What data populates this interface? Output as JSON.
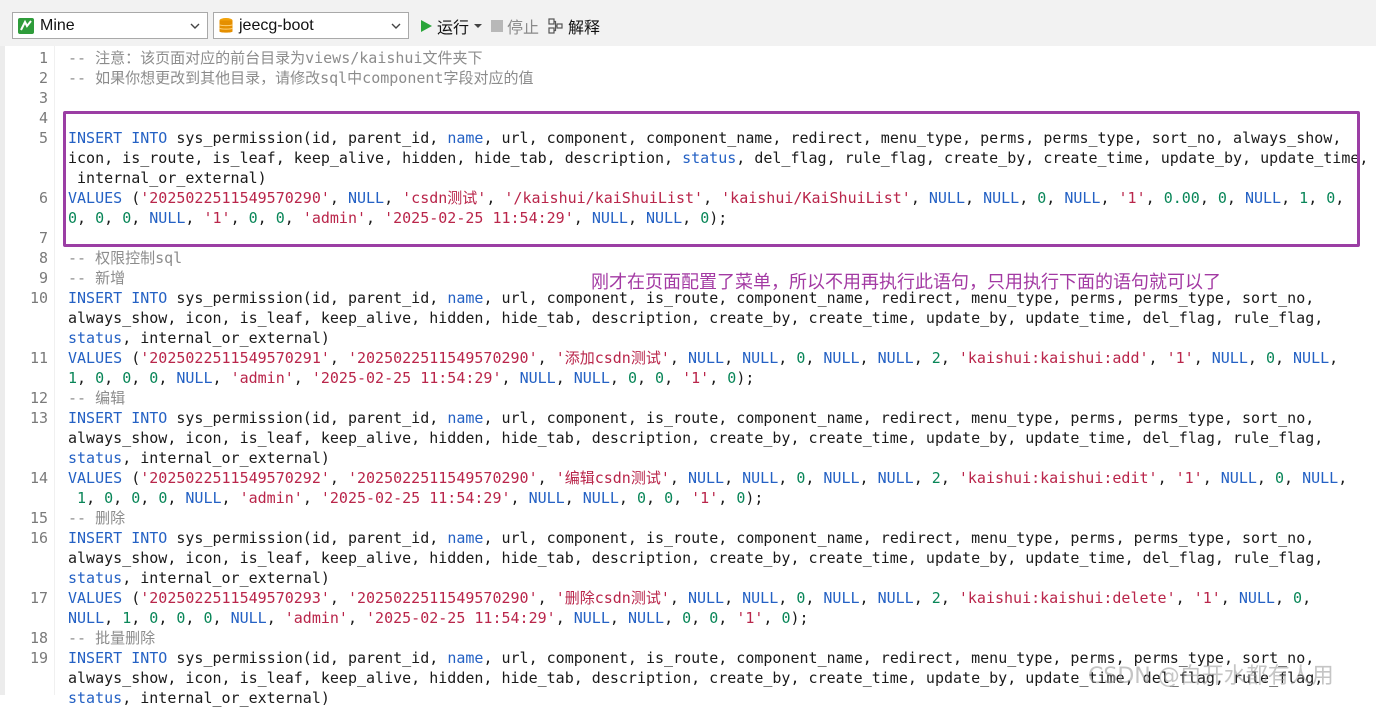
{
  "toolbar": {
    "connection": {
      "label": "Mine",
      "icon": "navicat-green-icon"
    },
    "database": {
      "label": "jeecg-boot",
      "icon": "database-icon"
    },
    "run_label": "运行",
    "stop_label": "停止",
    "explain_label": "解释"
  },
  "colors": {
    "keyword": "#2461c4",
    "string": "#b9254a",
    "number": "#098658",
    "comment": "#8c8c8c",
    "highlight_box": "#9b3ea4",
    "annotation": "#a33aa3"
  },
  "annotation": "刚才在页面配置了菜单，所以不用再执行此语句，只用执行下面的语句就可以了",
  "watermark": "CSDN @白开水都有人用",
  "line_numbers": [
    "1",
    "2",
    "3",
    "4",
    "5",
    "6",
    "7",
    "8",
    "9",
    "10",
    "11",
    "12",
    "13",
    "14",
    "15",
    "16",
    "17",
    "18",
    "19"
  ],
  "code": [
    [
      [
        "c",
        "-- 注意：该页面对应的前台目录为views/kaishui文件夹下"
      ]
    ],
    [
      [
        "c",
        "-- 如果你想更改到其他目录，请修改sql中component字段对应的值"
      ]
    ],
    [],
    [],
    [
      [
        "k",
        "INSERT INTO"
      ],
      [
        "t",
        " sys_permission(id, parent_id, "
      ],
      [
        "l",
        "name"
      ],
      [
        "t",
        ", url, component, component_name, redirect, menu_type, perms, perms_type, sort_no, always_show,"
      ]
    ],
    [
      [
        "t",
        "icon, is_route, is_leaf, keep_alive, hidden, hide_tab, description, "
      ],
      [
        "l",
        "status"
      ],
      [
        "t",
        ", del_flag, rule_flag, create_by, create_time, update_by, update_time,"
      ]
    ],
    [
      [
        "t",
        " internal_or_external)"
      ]
    ],
    [
      [
        "k",
        "VALUES"
      ],
      [
        "t",
        " ("
      ],
      [
        "s",
        "'2025022511549570290'"
      ],
      [
        "t",
        ", "
      ],
      [
        "u",
        "NULL"
      ],
      [
        "t",
        ", "
      ],
      [
        "s",
        "'csdn测试'"
      ],
      [
        "t",
        ", "
      ],
      [
        "s",
        "'/kaishui/kaiShuiList'"
      ],
      [
        "t",
        ", "
      ],
      [
        "s",
        "'kaishui/KaiShuiList'"
      ],
      [
        "t",
        ", "
      ],
      [
        "u",
        "NULL"
      ],
      [
        "t",
        ", "
      ],
      [
        "u",
        "NULL"
      ],
      [
        "t",
        ", "
      ],
      [
        "n",
        "0"
      ],
      [
        "t",
        ", "
      ],
      [
        "u",
        "NULL"
      ],
      [
        "t",
        ", "
      ],
      [
        "s",
        "'1'"
      ],
      [
        "t",
        ", "
      ],
      [
        "n",
        "0.00"
      ],
      [
        "t",
        ", "
      ],
      [
        "n",
        "0"
      ],
      [
        "t",
        ", "
      ],
      [
        "u",
        "NULL"
      ],
      [
        "t",
        ", "
      ],
      [
        "n",
        "1"
      ],
      [
        "t",
        ", "
      ],
      [
        "n",
        "0"
      ],
      [
        "t",
        ","
      ]
    ],
    [
      [
        "n",
        "0"
      ],
      [
        "t",
        ", "
      ],
      [
        "n",
        "0"
      ],
      [
        "t",
        ", "
      ],
      [
        "n",
        "0"
      ],
      [
        "t",
        ", "
      ],
      [
        "u",
        "NULL"
      ],
      [
        "t",
        ", "
      ],
      [
        "s",
        "'1'"
      ],
      [
        "t",
        ", "
      ],
      [
        "n",
        "0"
      ],
      [
        "t",
        ", "
      ],
      [
        "n",
        "0"
      ],
      [
        "t",
        ", "
      ],
      [
        "s",
        "'admin'"
      ],
      [
        "t",
        ", "
      ],
      [
        "s",
        "'2025-02-25 11:54:29'"
      ],
      [
        "t",
        ", "
      ],
      [
        "u",
        "NULL"
      ],
      [
        "t",
        ", "
      ],
      [
        "u",
        "NULL"
      ],
      [
        "t",
        ", "
      ],
      [
        "n",
        "0"
      ],
      [
        "t",
        ");"
      ]
    ],
    [],
    [
      [
        "c",
        "-- 权限控制sql"
      ]
    ],
    [
      [
        "c",
        "-- 新增"
      ]
    ],
    [
      [
        "k",
        "INSERT INTO"
      ],
      [
        "t",
        " sys_permission(id, parent_id, "
      ],
      [
        "l",
        "name"
      ],
      [
        "t",
        ", url, component, is_route, component_name, redirect, menu_type, perms, perms_type, sort_no,"
      ]
    ],
    [
      [
        "t",
        "always_show, icon, is_leaf, keep_alive, hidden, hide_tab, description, create_by, create_time, update_by, update_time, del_flag, rule_flag,"
      ]
    ],
    [
      [
        "l",
        "status"
      ],
      [
        "t",
        ", internal_or_external)"
      ]
    ],
    [
      [
        "k",
        "VALUES"
      ],
      [
        "t",
        " ("
      ],
      [
        "s",
        "'2025022511549570291'"
      ],
      [
        "t",
        ", "
      ],
      [
        "s",
        "'2025022511549570290'"
      ],
      [
        "t",
        ", "
      ],
      [
        "s",
        "'添加csdn测试'"
      ],
      [
        "t",
        ", "
      ],
      [
        "u",
        "NULL"
      ],
      [
        "t",
        ", "
      ],
      [
        "u",
        "NULL"
      ],
      [
        "t",
        ", "
      ],
      [
        "n",
        "0"
      ],
      [
        "t",
        ", "
      ],
      [
        "u",
        "NULL"
      ],
      [
        "t",
        ", "
      ],
      [
        "u",
        "NULL"
      ],
      [
        "t",
        ", "
      ],
      [
        "n",
        "2"
      ],
      [
        "t",
        ", "
      ],
      [
        "s",
        "'kaishui:kaishui:add'"
      ],
      [
        "t",
        ", "
      ],
      [
        "s",
        "'1'"
      ],
      [
        "t",
        ", "
      ],
      [
        "u",
        "NULL"
      ],
      [
        "t",
        ", "
      ],
      [
        "n",
        "0"
      ],
      [
        "t",
        ", "
      ],
      [
        "u",
        "NULL"
      ],
      [
        "t",
        ","
      ]
    ],
    [
      [
        "n",
        "1"
      ],
      [
        "t",
        ", "
      ],
      [
        "n",
        "0"
      ],
      [
        "t",
        ", "
      ],
      [
        "n",
        "0"
      ],
      [
        "t",
        ", "
      ],
      [
        "n",
        "0"
      ],
      [
        "t",
        ", "
      ],
      [
        "u",
        "NULL"
      ],
      [
        "t",
        ", "
      ],
      [
        "s",
        "'admin'"
      ],
      [
        "t",
        ", "
      ],
      [
        "s",
        "'2025-02-25 11:54:29'"
      ],
      [
        "t",
        ", "
      ],
      [
        "u",
        "NULL"
      ],
      [
        "t",
        ", "
      ],
      [
        "u",
        "NULL"
      ],
      [
        "t",
        ", "
      ],
      [
        "n",
        "0"
      ],
      [
        "t",
        ", "
      ],
      [
        "n",
        "0"
      ],
      [
        "t",
        ", "
      ],
      [
        "s",
        "'1'"
      ],
      [
        "t",
        ", "
      ],
      [
        "n",
        "0"
      ],
      [
        "t",
        ");"
      ]
    ],
    [
      [
        "c",
        "-- 编辑"
      ]
    ],
    [
      [
        "k",
        "INSERT INTO"
      ],
      [
        "t",
        " sys_permission(id, parent_id, "
      ],
      [
        "l",
        "name"
      ],
      [
        "t",
        ", url, component, is_route, component_name, redirect, menu_type, perms, perms_type, sort_no,"
      ]
    ],
    [
      [
        "t",
        "always_show, icon, is_leaf, keep_alive, hidden, hide_tab, description, create_by, create_time, update_by, update_time, del_flag, rule_flag,"
      ]
    ],
    [
      [
        "l",
        "status"
      ],
      [
        "t",
        ", internal_or_external)"
      ]
    ],
    [
      [
        "k",
        "VALUES"
      ],
      [
        "t",
        " ("
      ],
      [
        "s",
        "'2025022511549570292'"
      ],
      [
        "t",
        ", "
      ],
      [
        "s",
        "'2025022511549570290'"
      ],
      [
        "t",
        ", "
      ],
      [
        "s",
        "'编辑csdn测试'"
      ],
      [
        "t",
        ", "
      ],
      [
        "u",
        "NULL"
      ],
      [
        "t",
        ", "
      ],
      [
        "u",
        "NULL"
      ],
      [
        "t",
        ", "
      ],
      [
        "n",
        "0"
      ],
      [
        "t",
        ", "
      ],
      [
        "u",
        "NULL"
      ],
      [
        "t",
        ", "
      ],
      [
        "u",
        "NULL"
      ],
      [
        "t",
        ", "
      ],
      [
        "n",
        "2"
      ],
      [
        "t",
        ", "
      ],
      [
        "s",
        "'kaishui:kaishui:edit'"
      ],
      [
        "t",
        ", "
      ],
      [
        "s",
        "'1'"
      ],
      [
        "t",
        ", "
      ],
      [
        "u",
        "NULL"
      ],
      [
        "t",
        ", "
      ],
      [
        "n",
        "0"
      ],
      [
        "t",
        ", "
      ],
      [
        "u",
        "NULL"
      ],
      [
        "t",
        ","
      ]
    ],
    [
      [
        "t",
        " "
      ],
      [
        "n",
        "1"
      ],
      [
        "t",
        ", "
      ],
      [
        "n",
        "0"
      ],
      [
        "t",
        ", "
      ],
      [
        "n",
        "0"
      ],
      [
        "t",
        ", "
      ],
      [
        "n",
        "0"
      ],
      [
        "t",
        ", "
      ],
      [
        "u",
        "NULL"
      ],
      [
        "t",
        ", "
      ],
      [
        "s",
        "'admin'"
      ],
      [
        "t",
        ", "
      ],
      [
        "s",
        "'2025-02-25 11:54:29'"
      ],
      [
        "t",
        ", "
      ],
      [
        "u",
        "NULL"
      ],
      [
        "t",
        ", "
      ],
      [
        "u",
        "NULL"
      ],
      [
        "t",
        ", "
      ],
      [
        "n",
        "0"
      ],
      [
        "t",
        ", "
      ],
      [
        "n",
        "0"
      ],
      [
        "t",
        ", "
      ],
      [
        "s",
        "'1'"
      ],
      [
        "t",
        ", "
      ],
      [
        "n",
        "0"
      ],
      [
        "t",
        ");"
      ]
    ],
    [
      [
        "c",
        "-- 删除"
      ]
    ],
    [
      [
        "k",
        "INSERT INTO"
      ],
      [
        "t",
        " sys_permission(id, parent_id, "
      ],
      [
        "l",
        "name"
      ],
      [
        "t",
        ", url, component, is_route, component_name, redirect, menu_type, perms, perms_type, sort_no,"
      ]
    ],
    [
      [
        "t",
        "always_show, icon, is_leaf, keep_alive, hidden, hide_tab, description, create_by, create_time, update_by, update_time, del_flag, rule_flag,"
      ]
    ],
    [
      [
        "l",
        "status"
      ],
      [
        "t",
        ", internal_or_external)"
      ]
    ],
    [
      [
        "k",
        "VALUES"
      ],
      [
        "t",
        " ("
      ],
      [
        "s",
        "'2025022511549570293'"
      ],
      [
        "t",
        ", "
      ],
      [
        "s",
        "'2025022511549570290'"
      ],
      [
        "t",
        ", "
      ],
      [
        "s",
        "'删除csdn测试'"
      ],
      [
        "t",
        ", "
      ],
      [
        "u",
        "NULL"
      ],
      [
        "t",
        ", "
      ],
      [
        "u",
        "NULL"
      ],
      [
        "t",
        ", "
      ],
      [
        "n",
        "0"
      ],
      [
        "t",
        ", "
      ],
      [
        "u",
        "NULL"
      ],
      [
        "t",
        ", "
      ],
      [
        "u",
        "NULL"
      ],
      [
        "t",
        ", "
      ],
      [
        "n",
        "2"
      ],
      [
        "t",
        ", "
      ],
      [
        "s",
        "'kaishui:kaishui:delete'"
      ],
      [
        "t",
        ", "
      ],
      [
        "s",
        "'1'"
      ],
      [
        "t",
        ", "
      ],
      [
        "u",
        "NULL"
      ],
      [
        "t",
        ", "
      ],
      [
        "n",
        "0"
      ],
      [
        "t",
        ","
      ]
    ],
    [
      [
        "u",
        "NULL"
      ],
      [
        "t",
        ", "
      ],
      [
        "n",
        "1"
      ],
      [
        "t",
        ", "
      ],
      [
        "n",
        "0"
      ],
      [
        "t",
        ", "
      ],
      [
        "n",
        "0"
      ],
      [
        "t",
        ", "
      ],
      [
        "n",
        "0"
      ],
      [
        "t",
        ", "
      ],
      [
        "u",
        "NULL"
      ],
      [
        "t",
        ", "
      ],
      [
        "s",
        "'admin'"
      ],
      [
        "t",
        ", "
      ],
      [
        "s",
        "'2025-02-25 11:54:29'"
      ],
      [
        "t",
        ", "
      ],
      [
        "u",
        "NULL"
      ],
      [
        "t",
        ", "
      ],
      [
        "u",
        "NULL"
      ],
      [
        "t",
        ", "
      ],
      [
        "n",
        "0"
      ],
      [
        "t",
        ", "
      ],
      [
        "n",
        "0"
      ],
      [
        "t",
        ", "
      ],
      [
        "s",
        "'1'"
      ],
      [
        "t",
        ", "
      ],
      [
        "n",
        "0"
      ],
      [
        "t",
        ");"
      ]
    ],
    [
      [
        "c",
        "-- 批量删除"
      ]
    ],
    [
      [
        "k",
        "INSERT INTO"
      ],
      [
        "t",
        " sys_permission(id, parent_id, "
      ],
      [
        "l",
        "name"
      ],
      [
        "t",
        ", url, component, is_route, component_name, redirect, menu_type, perms, perms_type, sort_no,"
      ]
    ],
    [
      [
        "t",
        "always_show, icon, is_leaf, keep_alive, hidden, hide_tab, description, create_by, create_time, update_by, update_time, del_flag, rule_flag,"
      ]
    ],
    [
      [
        "l",
        "status"
      ],
      [
        "t",
        ", internal_or_external)"
      ]
    ]
  ]
}
